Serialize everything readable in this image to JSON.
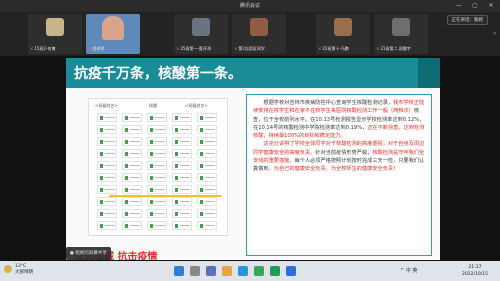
{
  "window": {
    "title": "腾讯会议",
    "controls": [
      "—",
      "▢",
      "✕"
    ]
  },
  "participants": [
    {
      "name": "15班2-何博",
      "muted": true,
      "avatar_color": "#c7b48a"
    },
    {
      "name": "程老师",
      "muted": true,
      "avatar_color": "#d9a48a",
      "active": true,
      "org": "吉林市第一中学"
    },
    {
      "name": "25班第一-夏开鸿",
      "muted": true,
      "avatar_color": "#6c7380"
    },
    {
      "name": "第2志愿区同学",
      "muted": true,
      "avatar_color": "#915c46"
    },
    {
      "name": "22班第十-马鹏",
      "muted": true,
      "avatar_color": "#9a6d4c"
    },
    {
      "name": "21班第二.邵晨宇",
      "muted": true,
      "avatar_color": "#6e6e6e"
    }
  ],
  "speaker_label": "正在讲话：甄妮",
  "slide": {
    "title": "抗疫千万条，核酸第一条。",
    "doc_labels": [
      "<班级姓名>",
      "核酸",
      "<班级姓名>"
    ],
    "slogan": "众志成城  抗击疫情",
    "para1_a": "根据学校对吉林市疾病防控中心查询学生核酸检测记录，",
    "para1_red1": "我市学校正陆续安排在校学生和在家不在校学生来医院核酸检测工作一般（两档次）",
    "para1_b": "核查，位于全校前列水平。在10.13号检测报告显示学校检测率达到0.12%，在10.14号的核酸检测中学院检测率达到0.19%，",
    "para1_red2": "正在不断完善，达到检测核酸，持续最100%的目标和稳定能力。",
    "para2_a": "这充分说明了学校全体同学对于核酸检测的高度重视，对于自身及周边同学健康安全的高度负责。",
    "para2_b": "针对当前疫情形势严峻，",
    "para2_red": "核酸检测是守牢我们全安线的重要措施。",
    "para2_c": "每个人必须严格按照计划按时完成三天一检，只要我们认真做到，",
    "para2_red2": "为自己的健康安全负责，为全校师生的健康安全负责！"
  },
  "meeting_badge": "● 甄妮的屏幕共享",
  "taskbar": {
    "weather_temp": "13°C",
    "weather_desc": "大部晴朗",
    "time": "21:17",
    "date": "2022/10/15",
    "tray": "^ 中 英"
  },
  "colors": {
    "accent": "#1a8c98",
    "slogan": "#e0322a",
    "highlight": "#f2bf20"
  }
}
